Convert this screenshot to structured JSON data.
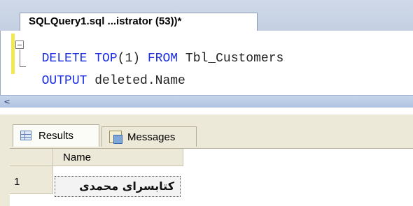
{
  "document_tab": {
    "title": "SQLQuery1.sql ...istrator (53))*"
  },
  "editor": {
    "lines": [
      {
        "keyword1": "DELETE",
        "keyword2": "TOP",
        "arg": "(1)",
        "keyword3": "FROM",
        "rest": "Tbl_Customers"
      },
      {
        "keyword1": "OUTPUT",
        "rest": "deleted.Name"
      }
    ]
  },
  "scrollbar": {
    "left_arrow": "<"
  },
  "results": {
    "tabs": [
      {
        "label": "Results",
        "icon": "grid-icon",
        "active": true
      },
      {
        "label": "Messages",
        "icon": "messages-icon",
        "active": false
      }
    ],
    "grid": {
      "columns": [
        "Name"
      ],
      "rows": [
        {
          "row_number": "1",
          "cells": [
            "کتابسرای محمدی"
          ]
        }
      ]
    }
  },
  "colors": {
    "keyword": "#1a2ee0",
    "tab_strip": "#c4d0e2",
    "panel": "#ece9d8",
    "change_margin": "#f2e94e"
  }
}
